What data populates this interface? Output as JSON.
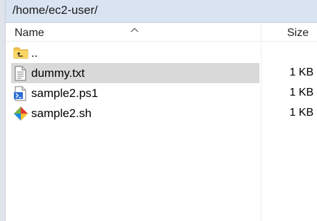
{
  "path": "/home/ec2-user/",
  "columns": {
    "name": "Name",
    "size": "Size"
  },
  "files": [
    {
      "name": "..",
      "size": "",
      "icon": "parent-folder-icon",
      "selected": false
    },
    {
      "name": "dummy.txt",
      "size": "1 KB",
      "icon": "text-file-icon",
      "selected": true
    },
    {
      "name": "sample2.ps1",
      "size": "1 KB",
      "icon": "powershell-script-icon",
      "selected": false
    },
    {
      "name": "sample2.sh",
      "size": "1 KB",
      "icon": "shell-script-icon",
      "selected": false
    }
  ]
}
